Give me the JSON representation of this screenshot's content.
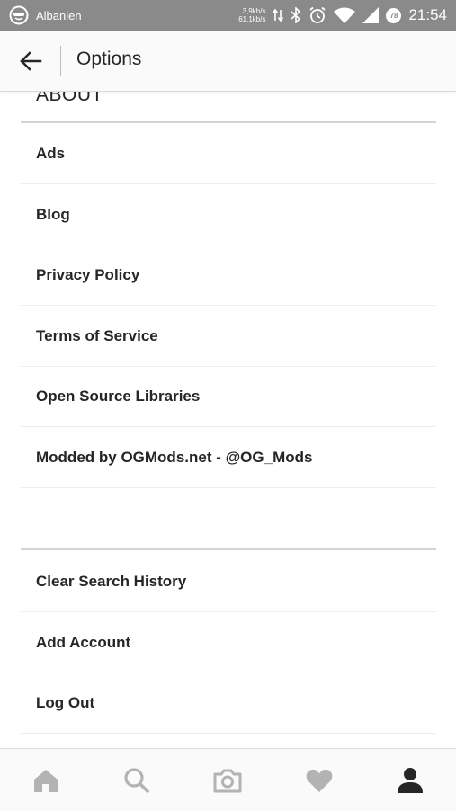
{
  "status_bar": {
    "carrier": "Albanien",
    "upload_speed": "3,9kb/s",
    "download_speed": "61,1kb/s",
    "battery_level": "78",
    "time": "21:54"
  },
  "app_bar": {
    "title": "Options"
  },
  "about_section": {
    "header": "ABOUT",
    "items": [
      {
        "label": "Ads"
      },
      {
        "label": "Blog"
      },
      {
        "label": "Privacy Policy"
      },
      {
        "label": "Terms of Service"
      },
      {
        "label": "Open Source Libraries"
      },
      {
        "label": "Modded by OGMods.net - @OG_Mods"
      }
    ]
  },
  "account_section": {
    "items": [
      {
        "label": "Clear Search History"
      },
      {
        "label": "Add Account"
      },
      {
        "label": "Log Out"
      }
    ]
  },
  "bottom_nav": {
    "items": [
      {
        "icon": "home-icon",
        "active": false
      },
      {
        "icon": "search-icon",
        "active": false
      },
      {
        "icon": "camera-icon",
        "active": false
      },
      {
        "icon": "heart-icon",
        "active": false
      },
      {
        "icon": "profile-icon",
        "active": true
      }
    ]
  },
  "colors": {
    "status_bar": "#8a8a8a",
    "inactive_icon": "#b3b3b3",
    "active_icon": "#262626",
    "text": "#262626"
  }
}
